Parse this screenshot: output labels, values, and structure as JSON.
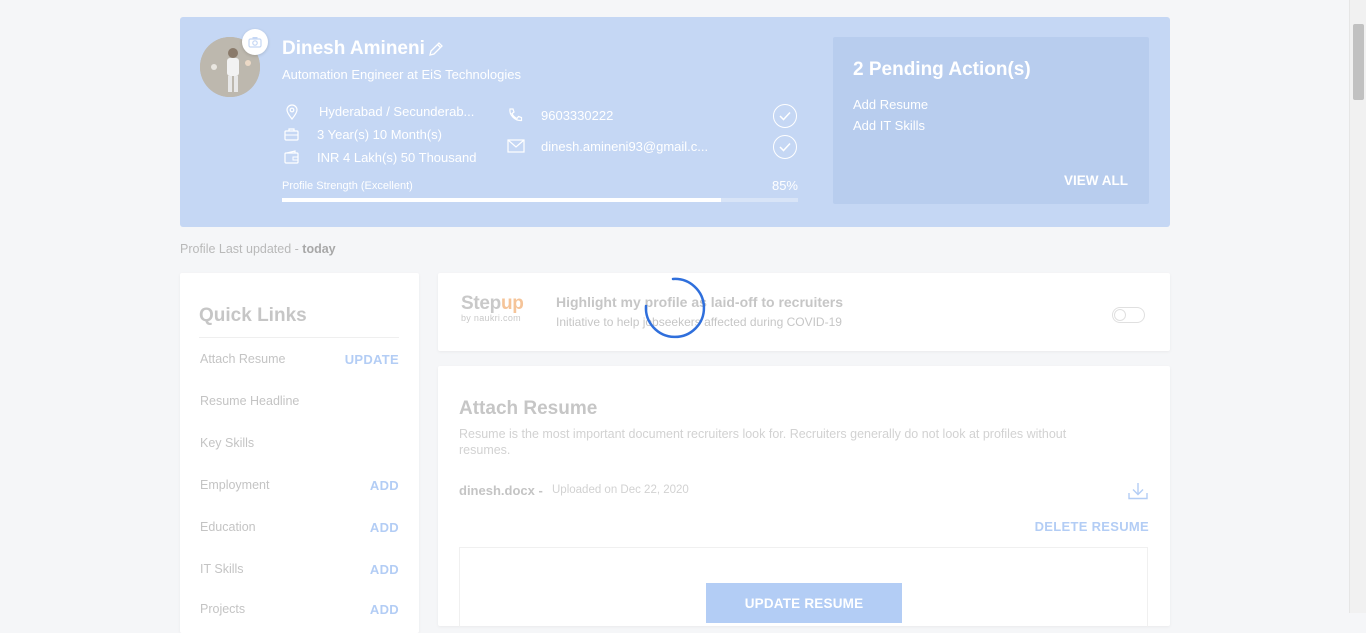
{
  "profile": {
    "name": "Dinesh Amineni",
    "title": "Automation Engineer at EiS Technologies",
    "location": "Hyderabad / Secunderab...",
    "experience": "3 Year(s) 10 Month(s)",
    "salary": "INR 4 Lakh(s) 50 Thousand",
    "phone": "9603330222",
    "email": "dinesh.amineni93@gmail.c...",
    "strength_label": "Profile Strength (Excellent)",
    "strength_pct": "85%",
    "strength_value": 0.85
  },
  "pending": {
    "title": "2 Pending Action(s)",
    "items": [
      "Add Resume",
      "Add IT Skills"
    ],
    "view_all": "VIEW ALL"
  },
  "last_updated": {
    "prefix": "Profile Last updated - ",
    "value": "today"
  },
  "quick_links": {
    "title": "Quick Links",
    "items": [
      {
        "label": "Attach Resume",
        "action": "UPDATE"
      },
      {
        "label": "Resume Headline",
        "action": ""
      },
      {
        "label": "Key Skills",
        "action": ""
      },
      {
        "label": "Employment",
        "action": "ADD"
      },
      {
        "label": "Education",
        "action": "ADD"
      },
      {
        "label": "IT Skills",
        "action": "ADD"
      },
      {
        "label": "Projects",
        "action": "ADD"
      }
    ]
  },
  "stepup": {
    "logo_main_a": "Step",
    "logo_main_b": "up",
    "logo_sub": "by naukri.com",
    "title": "Highlight my profile as laid-off to recruiters",
    "subtitle": "Initiative to help jobseekers affected during COVID-19"
  },
  "resume": {
    "title": "Attach Resume",
    "description": "Resume is the most important document recruiters look for. Recruiters generally do not look at profiles without resumes.",
    "file_name": "dinesh.docx -",
    "uploaded": "Uploaded on Dec 22, 2020",
    "delete_label": "DELETE RESUME",
    "update_label": "UPDATE RESUME"
  },
  "colors": {
    "header_bg": "#c5d7f4",
    "accent": "#b3cdf5",
    "spinner": "#2f6fdc"
  }
}
